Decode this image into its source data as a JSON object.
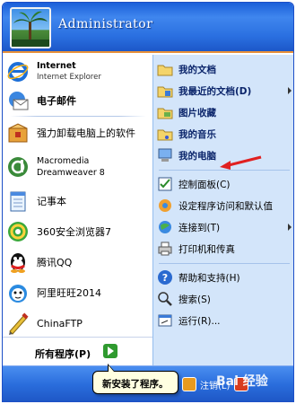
{
  "user": {
    "name": "Administrator"
  },
  "left": {
    "pinned": [
      {
        "title": "Internet",
        "subtitle": "Internet Explorer",
        "icon": "internet-explorer-icon"
      },
      {
        "title": "电子邮件",
        "icon": "email-icon"
      }
    ],
    "recent": [
      {
        "label": "强力卸载电脑上的软件",
        "icon": "uninstaller-icon"
      },
      {
        "label": "Macromedia Dreamweaver 8",
        "icon": "dreamweaver-icon"
      },
      {
        "label": "记事本",
        "icon": "notepad-icon"
      },
      {
        "label": "360安全浏览器7",
        "icon": "360-browser-icon"
      },
      {
        "label": "腾讯QQ",
        "icon": "qq-icon"
      },
      {
        "label": "阿里旺旺2014",
        "icon": "aliwangwang-icon"
      },
      {
        "label": "ChinaFTP",
        "icon": "chinaftp-icon"
      }
    ],
    "all_programs": "所有程序(P)"
  },
  "right": {
    "items": [
      {
        "label": "我的文档",
        "icon": "my-documents-icon",
        "bold": true,
        "submenu": false
      },
      {
        "label": "我最近的文档(D)",
        "icon": "recent-documents-icon",
        "bold": true,
        "submenu": true
      },
      {
        "label": "图片收藏",
        "icon": "my-pictures-icon",
        "bold": true,
        "submenu": false
      },
      {
        "label": "我的音乐",
        "icon": "my-music-icon",
        "bold": true,
        "submenu": false
      },
      {
        "label": "我的电脑",
        "icon": "my-computer-icon",
        "bold": true,
        "submenu": false
      },
      {
        "label": "控制面板(C)",
        "icon": "control-panel-icon",
        "bold": false,
        "submenu": false
      },
      {
        "label": "设定程序访问和默认值",
        "icon": "program-access-icon",
        "bold": false,
        "submenu": false
      },
      {
        "label": "连接到(T)",
        "icon": "connect-to-icon",
        "bold": false,
        "submenu": true
      },
      {
        "label": "打印机和传真",
        "icon": "printer-icon",
        "bold": false,
        "submenu": false
      },
      {
        "label": "帮助和支持(H)",
        "icon": "help-icon",
        "bold": false,
        "submenu": false
      },
      {
        "label": "搜索(S)",
        "icon": "search-icon",
        "bold": false,
        "submenu": false
      },
      {
        "label": "运行(R)...",
        "icon": "run-icon",
        "bold": false,
        "submenu": false
      }
    ]
  },
  "footer": {
    "logoff_label": "注销(L)",
    "watermark": "Bai 经验"
  },
  "tooltip": "新安装了程序。",
  "colors": {
    "header_blue": "#2a6fe0",
    "right_panel": "#d3e5fa",
    "footer_blue": "#2a6ddc",
    "annotation_red": "#e02020"
  }
}
